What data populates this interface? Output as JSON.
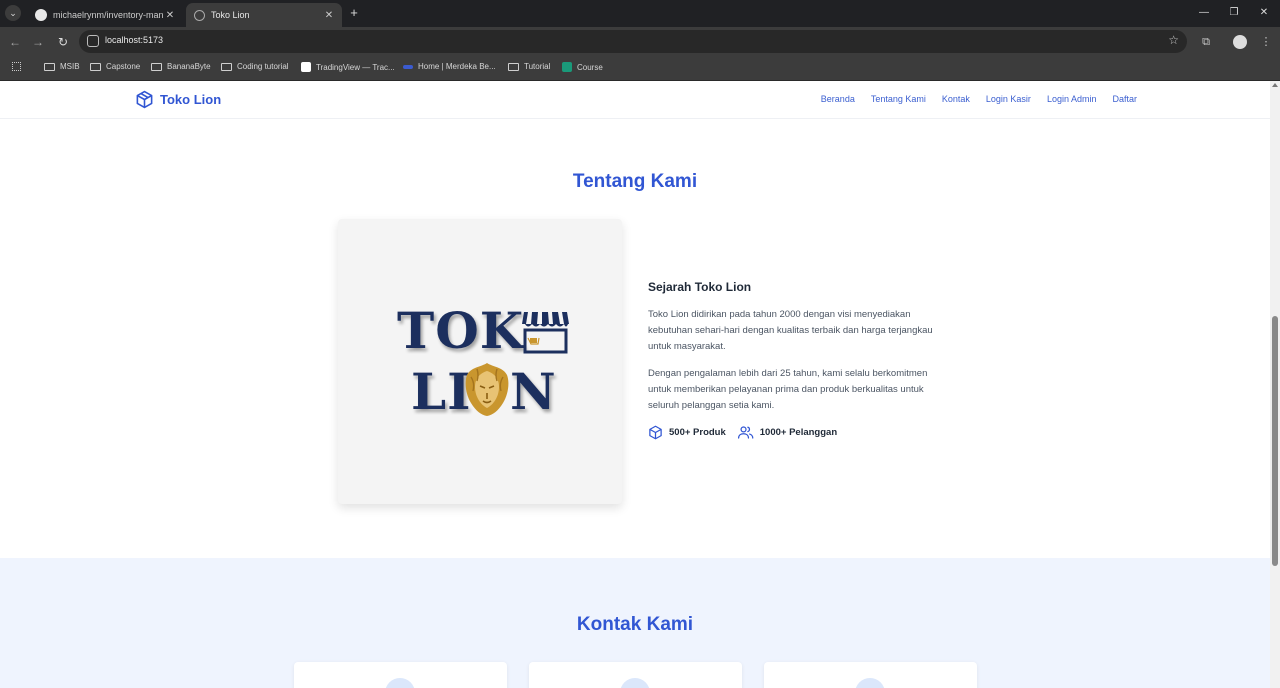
{
  "browser": {
    "tabs": [
      {
        "title": "michaelrynm/inventory-manag",
        "active": false
      },
      {
        "title": "Toko Lion",
        "active": true
      }
    ],
    "address": "localhost:5173",
    "bookmarks": [
      "MSIB",
      "Capstone",
      "BananaByte",
      "Coding tutorial",
      "TradingView — Trac...",
      "Home | Merdeka Be...",
      "Tutorial",
      "Course"
    ]
  },
  "site": {
    "brand": "Toko Lion",
    "nav": [
      "Beranda",
      "Tentang Kami",
      "Kontak",
      "Login Kasir",
      "Login Admin",
      "Daftar"
    ],
    "about": {
      "title": "Tentang Kami",
      "logo_line1": "TOK",
      "logo_line2": "LI",
      "logo_line3": "N",
      "heading": "Sejarah Toko Lion",
      "paragraph1": "Toko Lion didirikan pada tahun 2000 dengan visi menyediakan kebutuhan sehari-hari dengan kualitas terbaik dan harga terjangkau untuk masyarakat.",
      "paragraph2": "Dengan pengalaman lebih dari 25 tahun, kami selalu berkomitmen untuk memberikan pelayanan prima dan produk berkualitas untuk seluruh pelanggan setia kami.",
      "stat_products": "500+ Produk",
      "stat_customers": "1000+ Pelanggan"
    },
    "contact": {
      "title": "Kontak Kami"
    }
  },
  "colors": {
    "primary": "#3156d3",
    "logo_navy": "#1c2f5e",
    "logo_gold": "#c9962e",
    "contact_bg": "#eff4fe"
  }
}
